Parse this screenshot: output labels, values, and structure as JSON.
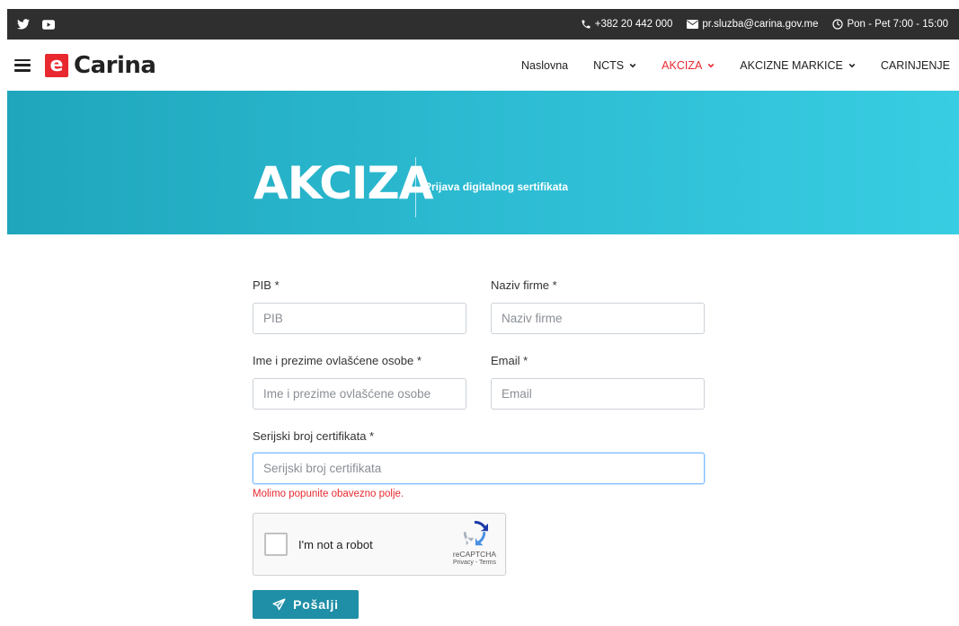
{
  "topbar": {
    "phone": "+382 20 442 000",
    "email": "pr.sluzba@carina.gov.me",
    "hours": "Pon - Pet 7:00 - 15:00"
  },
  "brand": {
    "logo_letter": "e",
    "name": "Carina"
  },
  "nav": {
    "items": [
      {
        "label": "Naslovna",
        "dropdown": false,
        "active": false
      },
      {
        "label": "NCTS",
        "dropdown": true,
        "active": false
      },
      {
        "label": "AKCIZA",
        "dropdown": true,
        "active": true
      },
      {
        "label": "AKCIZNE MARKICE",
        "dropdown": true,
        "active": false
      },
      {
        "label": "CARINJENJE",
        "dropdown": false,
        "active": false
      }
    ]
  },
  "hero": {
    "title": "AKCIZA",
    "subtitle": "Prijava digitalnog sertifikata"
  },
  "form": {
    "pib": {
      "label": "PIB *",
      "placeholder": "PIB",
      "value": ""
    },
    "naziv": {
      "label": "Naziv firme *",
      "placeholder": "Naziv firme",
      "value": ""
    },
    "ime": {
      "label": "Ime i prezime ovlašćene osobe *",
      "placeholder": "Ime i prezime ovlašćene osobe",
      "value": ""
    },
    "email": {
      "label": "Email *",
      "placeholder": "Email",
      "value": ""
    },
    "serijski": {
      "label": "Serijski broj certifikata *",
      "placeholder": "Serijski broj certifikata",
      "value": ""
    },
    "error": "Molimo popunite obavezno polje.",
    "captcha": {
      "text": "I'm not a robot",
      "brand": "reCAPTCHA",
      "links": "Privacy - Terms"
    },
    "submit": "Pošalji"
  },
  "colors": {
    "accent": "#e8292f",
    "teal": "#1e8fa6",
    "topbar": "#2f2f2f"
  }
}
